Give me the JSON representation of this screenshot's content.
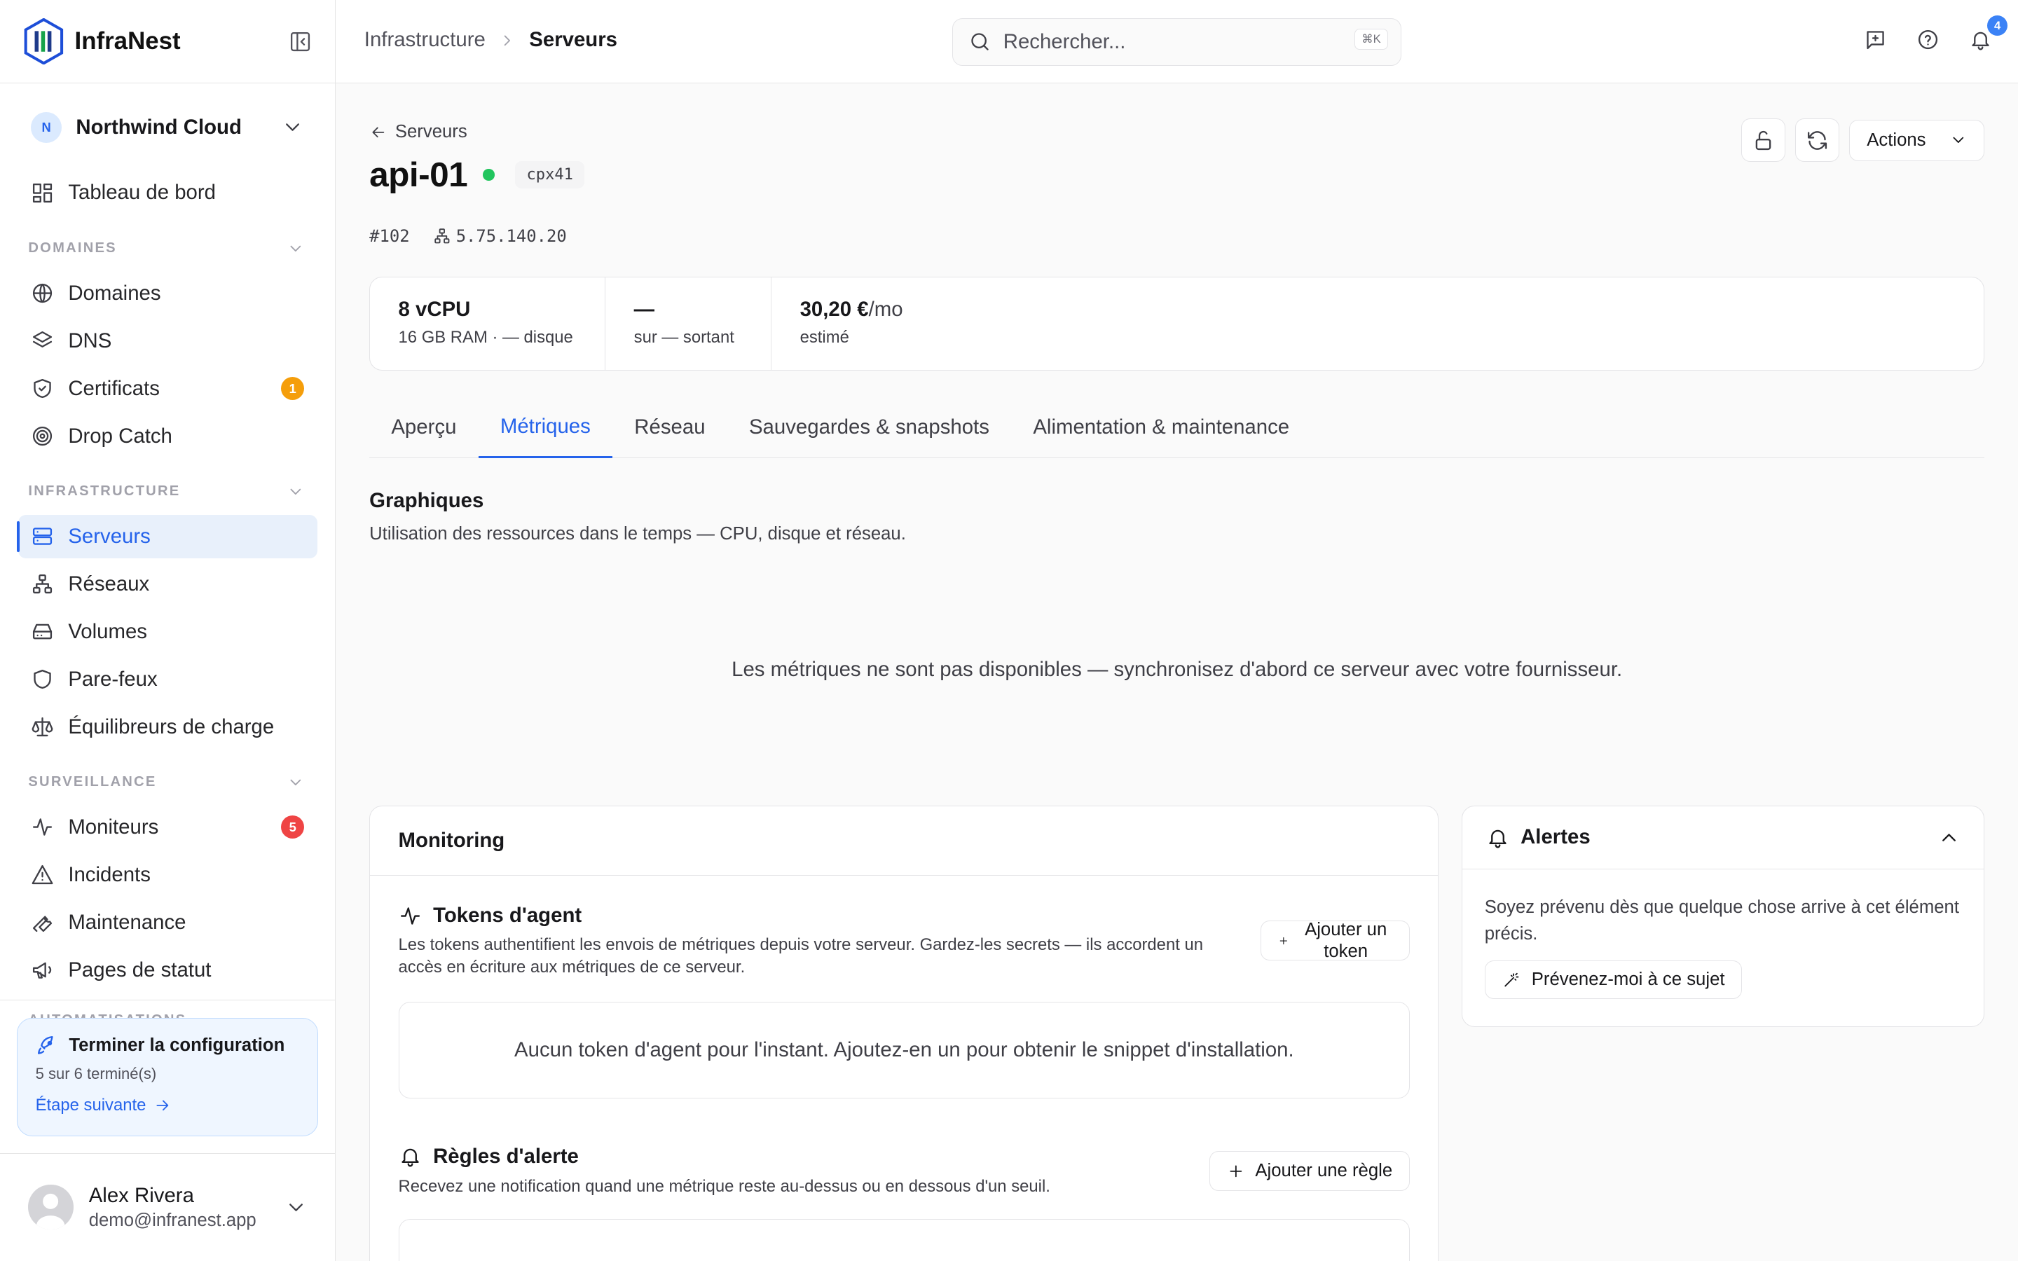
{
  "app": {
    "name": "InfraNest"
  },
  "org": {
    "initial": "N",
    "name": "Northwind Cloud"
  },
  "sidebar": {
    "dashboard": "Tableau de bord",
    "sections": [
      {
        "label": "DOMAINES",
        "items": [
          {
            "label": "Domaines",
            "icon": "globe-icon"
          },
          {
            "label": "DNS",
            "icon": "layers-icon"
          },
          {
            "label": "Certificats",
            "icon": "shield-check-icon",
            "badge": "1"
          },
          {
            "label": "Drop Catch",
            "icon": "target-icon"
          }
        ]
      },
      {
        "label": "INFRASTRUCTURE",
        "items": [
          {
            "label": "Serveurs",
            "icon": "server-icon",
            "active": true
          },
          {
            "label": "Réseaux",
            "icon": "network-icon"
          },
          {
            "label": "Volumes",
            "icon": "hard-drive-icon"
          },
          {
            "label": "Pare-feux",
            "icon": "shield-icon"
          },
          {
            "label": "Équilibreurs de charge",
            "icon": "scale-icon"
          }
        ]
      },
      {
        "label": "SURVEILLANCE",
        "items": [
          {
            "label": "Moniteurs",
            "icon": "activity-icon",
            "badge": "5"
          },
          {
            "label": "Incidents",
            "icon": "alert-triangle-icon"
          },
          {
            "label": "Maintenance",
            "icon": "wrench-icon"
          },
          {
            "label": "Pages de statut",
            "icon": "megaphone-icon"
          }
        ]
      },
      {
        "label": "AUTOMATISATIONS",
        "items": []
      }
    ]
  },
  "setup": {
    "title": "Terminer la configuration",
    "progress": "5 sur 6 terminé(s)",
    "link": "Étape suivante"
  },
  "user": {
    "name": "Alex Rivera",
    "email": "demo@infranest.app"
  },
  "topbar": {
    "breadcrumb": [
      "Infrastructure",
      "Serveurs"
    ],
    "search_placeholder": "Rechercher...",
    "search_shortcut": "⌘K",
    "notifications_count": "4"
  },
  "server": {
    "back_label": "Serveurs",
    "name": "api-01",
    "status_color": "#22c55e",
    "type": "cpx41",
    "id": "#102",
    "ip": "5.75.140.20",
    "actions_label": "Actions"
  },
  "stats": [
    {
      "value": "8 vCPU",
      "sub": "16 GB RAM · — disque"
    },
    {
      "value": "—",
      "sub": "sur — sortant"
    },
    {
      "value": "30,20 €",
      "unit": "/mo",
      "sub": "estimé"
    }
  ],
  "tabs": [
    "Aperçu",
    "Métriques",
    "Réseau",
    "Sauvegardes & snapshots",
    "Alimentation & maintenance"
  ],
  "active_tab": "Métriques",
  "graphs": {
    "title": "Graphiques",
    "subtitle": "Utilisation des ressources dans le temps — CPU, disque et réseau.",
    "empty": "Les métriques ne sont pas disponibles — synchronisez d'abord ce serveur avec votre fournisseur."
  },
  "monitoring": {
    "title": "Monitoring",
    "tokens": {
      "title": "Tokens d'agent",
      "description": "Les tokens authentifient les envois de métriques depuis votre serveur. Gardez-les secrets — ils accordent un accès en écriture aux métriques de ce serveur.",
      "button": "Ajouter un token",
      "empty": "Aucun token d'agent pour l'instant. Ajoutez-en un pour obtenir le snippet d'installation."
    },
    "rules": {
      "title": "Règles d'alerte",
      "description": "Recevez une notification quand une métrique reste au-dessus ou en dessous d'un seuil.",
      "button": "Ajouter une règle"
    }
  },
  "alerts": {
    "title": "Alertes",
    "description": "Soyez prévenu dès que quelque chose arrive à cet élément précis.",
    "button": "Prévenez-moi à ce sujet"
  },
  "colors": {
    "accent": "#2563eb",
    "active_bg": "#e8f0fb",
    "badge_amber": "#f59e0b",
    "badge_red": "#ef4444"
  }
}
